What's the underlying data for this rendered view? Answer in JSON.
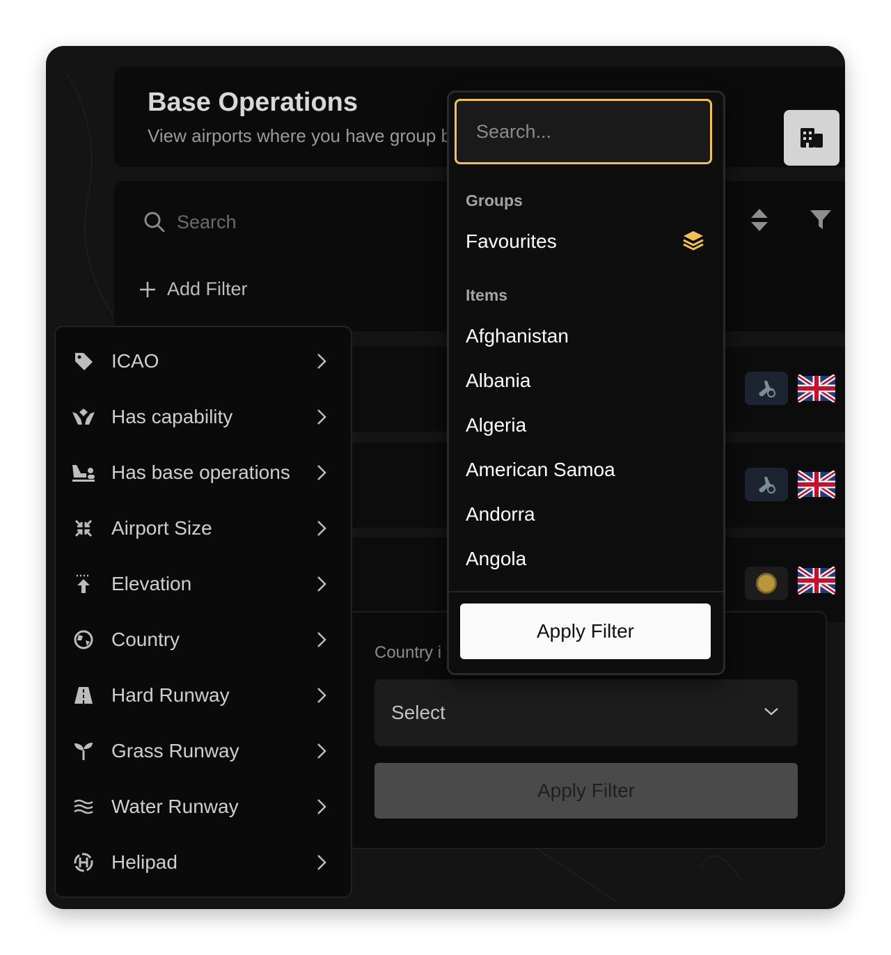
{
  "header": {
    "title": "Base Operations",
    "subtitle": "View airports where you have group base operations"
  },
  "view_toggle": {
    "active_icon": "building-icon",
    "inactive_icon": "airplane-icon"
  },
  "toolbar": {
    "search_placeholder": "Search",
    "add_filter_label": "Add Filter",
    "sort_icon": "sort-icon",
    "filter_icon": "funnel-icon"
  },
  "filter_menu": {
    "items": [
      {
        "label": "ICAO",
        "icon": "tag-icon"
      },
      {
        "label": "Has capability",
        "icon": "hands-capability-icon"
      },
      {
        "label": "Has base operations",
        "icon": "base-operations-icon"
      },
      {
        "label": "Airport Size",
        "icon": "compress-icon"
      },
      {
        "label": "Elevation",
        "icon": "elevation-arrow-icon"
      },
      {
        "label": "Country",
        "icon": "globe-icon"
      },
      {
        "label": "Hard Runway",
        "icon": "road-icon"
      },
      {
        "label": "Grass Runway",
        "icon": "sprout-icon"
      },
      {
        "label": "Water Runway",
        "icon": "water-icon"
      },
      {
        "label": "Helipad",
        "icon": "helipad-icon"
      }
    ]
  },
  "country_panel": {
    "label": "Country i",
    "select_value": "Select",
    "apply_label": "Apply Filter"
  },
  "dropdown": {
    "search_placeholder": "Search...",
    "groups_heading": "Groups",
    "groups": [
      {
        "label": "Favourites",
        "icon": "layers-icon"
      }
    ],
    "items_heading": "Items",
    "items": [
      "Afghanistan",
      "Albania",
      "Algeria",
      "American Samoa",
      "Andorra",
      "Angola"
    ],
    "apply_label": "Apply Filter"
  },
  "colors": {
    "accent": "#f2c14e",
    "background": "#141414",
    "panel": "#0b0b0b"
  }
}
